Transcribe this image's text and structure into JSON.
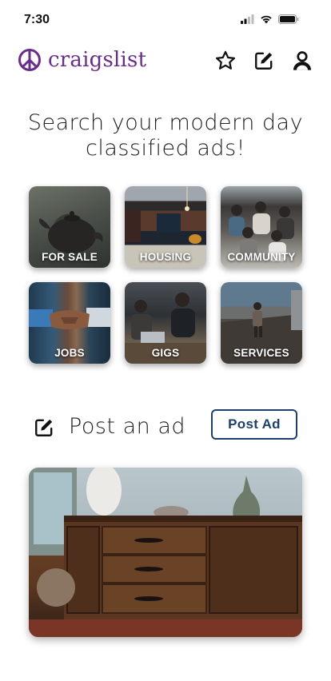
{
  "status": {
    "time": "7:30"
  },
  "brand": {
    "name": "craigslist",
    "color": "#6a2c8e"
  },
  "header": {
    "icons": [
      "favorites-star-icon",
      "edit-icon",
      "account-icon"
    ]
  },
  "headline": {
    "line1": "Search your modern day",
    "line2": "classified ads!"
  },
  "categories": [
    {
      "label": "FOR SALE"
    },
    {
      "label": "HOUSING"
    },
    {
      "label": "COMMUNITY"
    },
    {
      "label": "JOBS"
    },
    {
      "label": "GIGS"
    },
    {
      "label": "SERVICES"
    }
  ],
  "post": {
    "title": "Post an ad",
    "button_label": "Post Ad",
    "accent": "#1c3f6e"
  }
}
